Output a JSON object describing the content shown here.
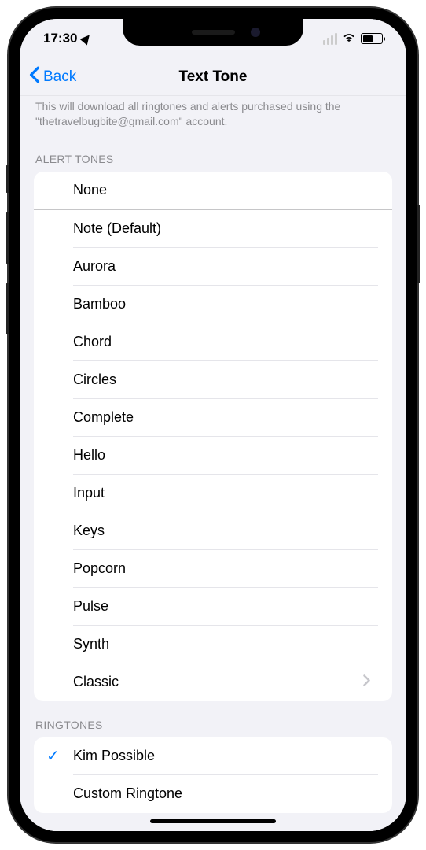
{
  "statusBar": {
    "time": "17:30"
  },
  "navBar": {
    "backLabel": "Back",
    "title": "Text Tone"
  },
  "description": "This will download all ringtones and alerts purchased using the \"thetravelbugbite@gmail.com\" account.",
  "sections": {
    "alertTones": {
      "header": "ALERT TONES",
      "none": "None",
      "items": [
        "Note (Default)",
        "Aurora",
        "Bamboo",
        "Chord",
        "Circles",
        "Complete",
        "Hello",
        "Input",
        "Keys",
        "Popcorn",
        "Pulse",
        "Synth",
        "Classic"
      ]
    },
    "ringtones": {
      "header": "RINGTONES",
      "items": [
        {
          "label": "Kim Possible",
          "selected": true
        },
        {
          "label": "Custom Ringtone",
          "selected": false
        }
      ]
    }
  }
}
